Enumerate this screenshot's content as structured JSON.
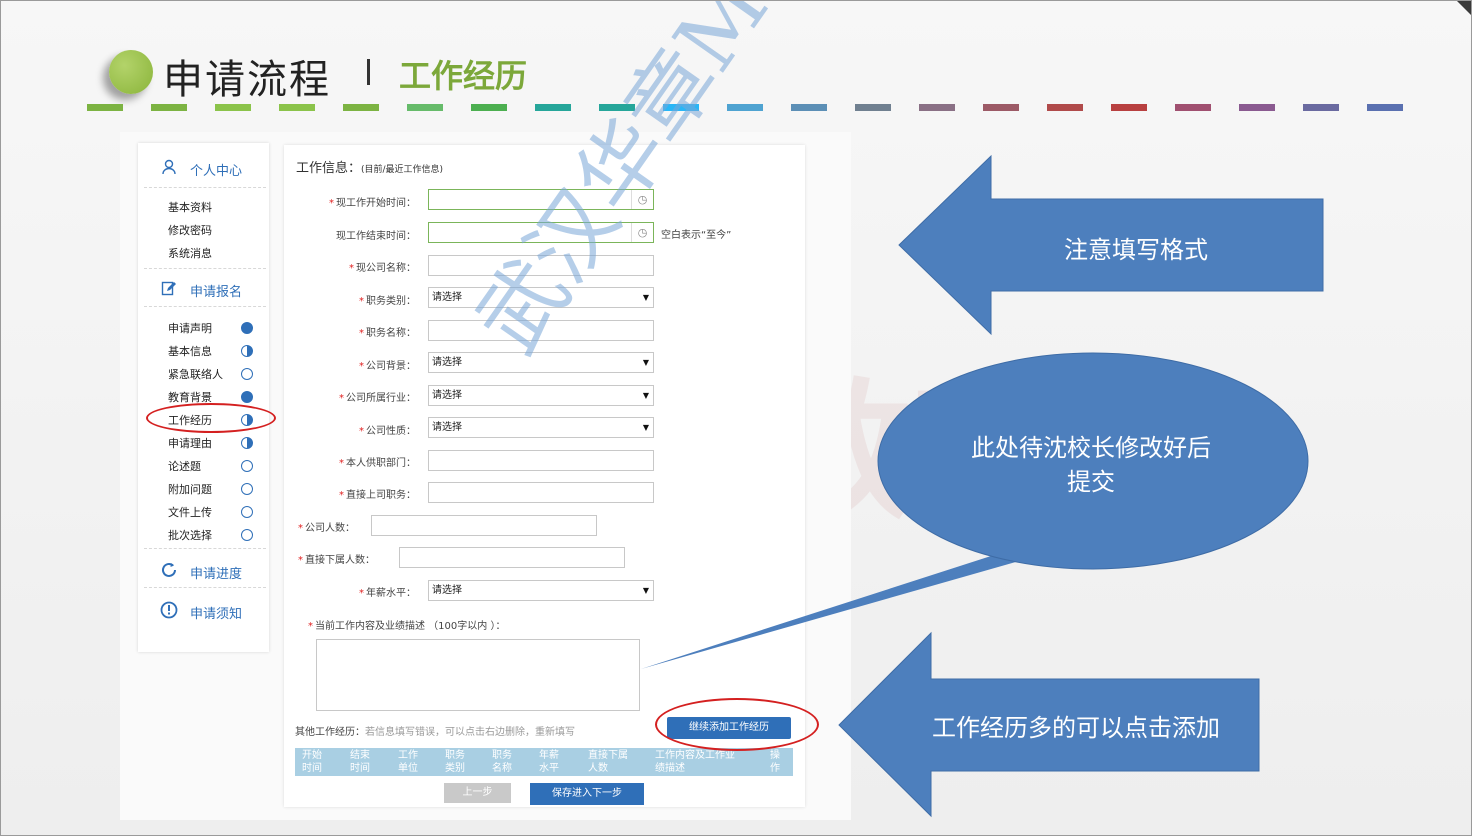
{
  "header": {
    "title": "申请流程",
    "subtitle": "工作经历"
  },
  "sidebar": {
    "personal_center": "个人中心",
    "personal_items": [
      "基本资料",
      "修改密码",
      "系统消息"
    ],
    "apply": "申请报名",
    "apply_items": [
      {
        "label": "申请声明",
        "status": "full"
      },
      {
        "label": "基本信息",
        "status": "half"
      },
      {
        "label": "紧急联络人",
        "status": "empty"
      },
      {
        "label": "教育背景",
        "status": "full"
      },
      {
        "label": "工作经历",
        "status": "half"
      },
      {
        "label": "申请理由",
        "status": "half"
      },
      {
        "label": "论述题",
        "status": "empty"
      },
      {
        "label": "附加问题",
        "status": "empty"
      },
      {
        "label": "文件上传",
        "status": "empty"
      },
      {
        "label": "批次选择",
        "status": "empty"
      }
    ],
    "progress": "申请进度",
    "notice": "申请须知"
  },
  "form": {
    "title": "工作信息：",
    "title_note": "(目前/最近工作信息)",
    "start_time_label": "现工作开始时间：",
    "end_time_label": "现工作结束时间：",
    "end_time_hint": "空白表示“至今”",
    "company_name_label": "现公司名称：",
    "job_type_label": "职务类别：",
    "job_title_label": "职务名称：",
    "company_bg_label": "公司背景：",
    "industry_label": "公司所属行业：",
    "company_nature_label": "公司性质：",
    "department_label": "本人供职部门：",
    "supervisor_label": "直接上司职务：",
    "company_size_label": "公司人数：",
    "subordinates_label": "直接下属人数：",
    "salary_label": "年薪水平：",
    "select_placeholder": "请选择",
    "description_label": "当前工作内容及业绩描述 （100字以内 ）：",
    "other_label": "其他工作经历：",
    "other_hint": "若信息填写错误，可以点击右边删除，重新填写",
    "add_button": "继续添加工作经历",
    "table_headers": [
      "开始\n时间",
      "结束\n时间",
      "工作\n单位",
      "职务\n类别",
      "职务\n名称",
      "年薪\n水平",
      "直接下属\n人数",
      "工作内容及工作业\n绩描述",
      "操\n作"
    ],
    "prev_button": "上一步",
    "next_button": "保存进入下一步"
  },
  "annotations": {
    "format_note": "注意填写格式",
    "submit_note": "此处待沈校长修改好后\n提交",
    "add_note": "工作经历多的可以点击添加",
    "watermark": "武汉华章MBA"
  },
  "colors": {
    "accent": "#2f6fb8",
    "callout": "#4d7fbd",
    "header_green": "#7ca83a",
    "required": "#e02020"
  }
}
